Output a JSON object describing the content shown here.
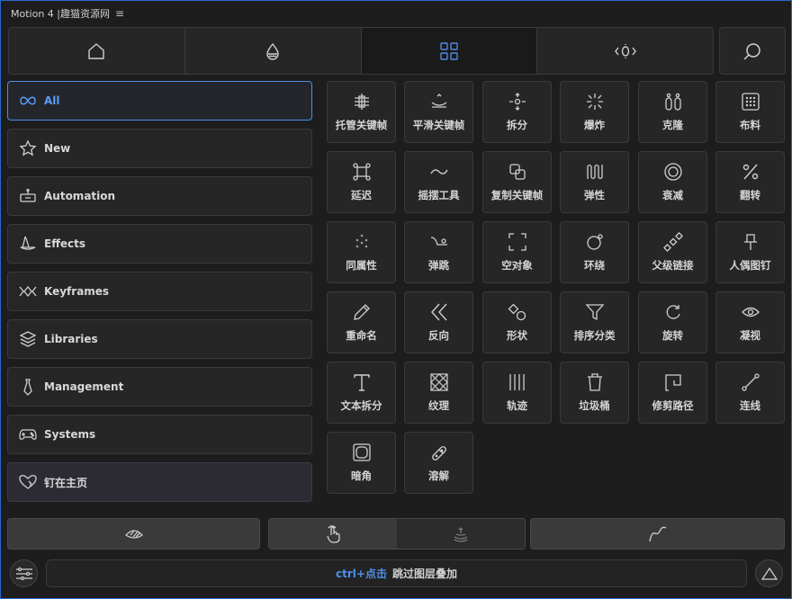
{
  "app": {
    "title": "Motion 4 |趣猫资源网",
    "menu_glyph": "≡"
  },
  "topnav": {
    "tabs": [
      "home-icon",
      "water-drop-icon",
      "grid-icon",
      "keyframe-zero-icon"
    ],
    "active_index": 2
  },
  "sidebar": {
    "items": [
      {
        "label": "All",
        "icon": "infinity-icon",
        "active": true
      },
      {
        "label": "New",
        "icon": "star-icon"
      },
      {
        "label": "Automation",
        "icon": "robot-icon"
      },
      {
        "label": "Effects",
        "icon": "wizard-hat-icon"
      },
      {
        "label": "Keyframes",
        "icon": "keyframes-icon"
      },
      {
        "label": "Libraries",
        "icon": "stack-icon"
      },
      {
        "label": "Management",
        "icon": "tie-icon"
      },
      {
        "label": "Systems",
        "icon": "gamepad-icon"
      },
      {
        "label": "钉在主页",
        "icon": "heart-pin-icon",
        "pinned": true
      }
    ]
  },
  "tools": [
    {
      "label": "托管关键帧",
      "icon": "keyframe-handle-icon"
    },
    {
      "label": "平滑关键帧",
      "icon": "smooth-keyframe-icon"
    },
    {
      "label": "拆分",
      "icon": "split-icon"
    },
    {
      "label": "爆炸",
      "icon": "explode-icon"
    },
    {
      "label": "克隆",
      "icon": "clone-icon"
    },
    {
      "label": "布料",
      "icon": "cloth-icon"
    },
    {
      "label": "延迟",
      "icon": "delay-icon"
    },
    {
      "label": "摇摆工具",
      "icon": "wiggle-icon"
    },
    {
      "label": "复制关键帧",
      "icon": "copy-keyframe-icon"
    },
    {
      "label": "弹性",
      "icon": "elastic-icon"
    },
    {
      "label": "衰减",
      "icon": "falloff-icon"
    },
    {
      "label": "翻转",
      "icon": "flip-icon"
    },
    {
      "label": "同属性",
      "icon": "same-property-icon"
    },
    {
      "label": "弹跳",
      "icon": "bounce-icon"
    },
    {
      "label": "空对象",
      "icon": "null-object-icon"
    },
    {
      "label": "环绕",
      "icon": "orbit-icon"
    },
    {
      "label": "父级链接",
      "icon": "parent-chain-icon"
    },
    {
      "label": "人偶图钉",
      "icon": "puppet-pin-icon"
    },
    {
      "label": "重命名",
      "icon": "pencil-icon"
    },
    {
      "label": "反向",
      "icon": "reverse-icon"
    },
    {
      "label": "形状",
      "icon": "shapes-icon"
    },
    {
      "label": "排序分类",
      "icon": "funnel-icon"
    },
    {
      "label": "旋转",
      "icon": "rotate-icon"
    },
    {
      "label": "凝视",
      "icon": "eye-icon"
    },
    {
      "label": "文本拆分",
      "icon": "text-icon"
    },
    {
      "label": "纹理",
      "icon": "texture-icon"
    },
    {
      "label": "轨迹",
      "icon": "trail-icon"
    },
    {
      "label": "垃圾桶",
      "icon": "trash-icon"
    },
    {
      "label": "修剪路径",
      "icon": "trim-path-icon"
    },
    {
      "label": "连线",
      "icon": "connect-icon"
    },
    {
      "label": "暗角",
      "icon": "vignette-icon"
    },
    {
      "label": "溶解",
      "icon": "dissolve-icon"
    }
  ],
  "bottom": {
    "buttons": [
      "eye-swirl-icon",
      "touch-icon",
      "stack-layers-icon",
      "curve-icon"
    ]
  },
  "hint": {
    "key": "ctrl+点击",
    "text": "跳过图层叠加"
  },
  "colors": {
    "accent": "#4f8be6",
    "bg": "#1d1d1d",
    "panel": "#262626"
  }
}
